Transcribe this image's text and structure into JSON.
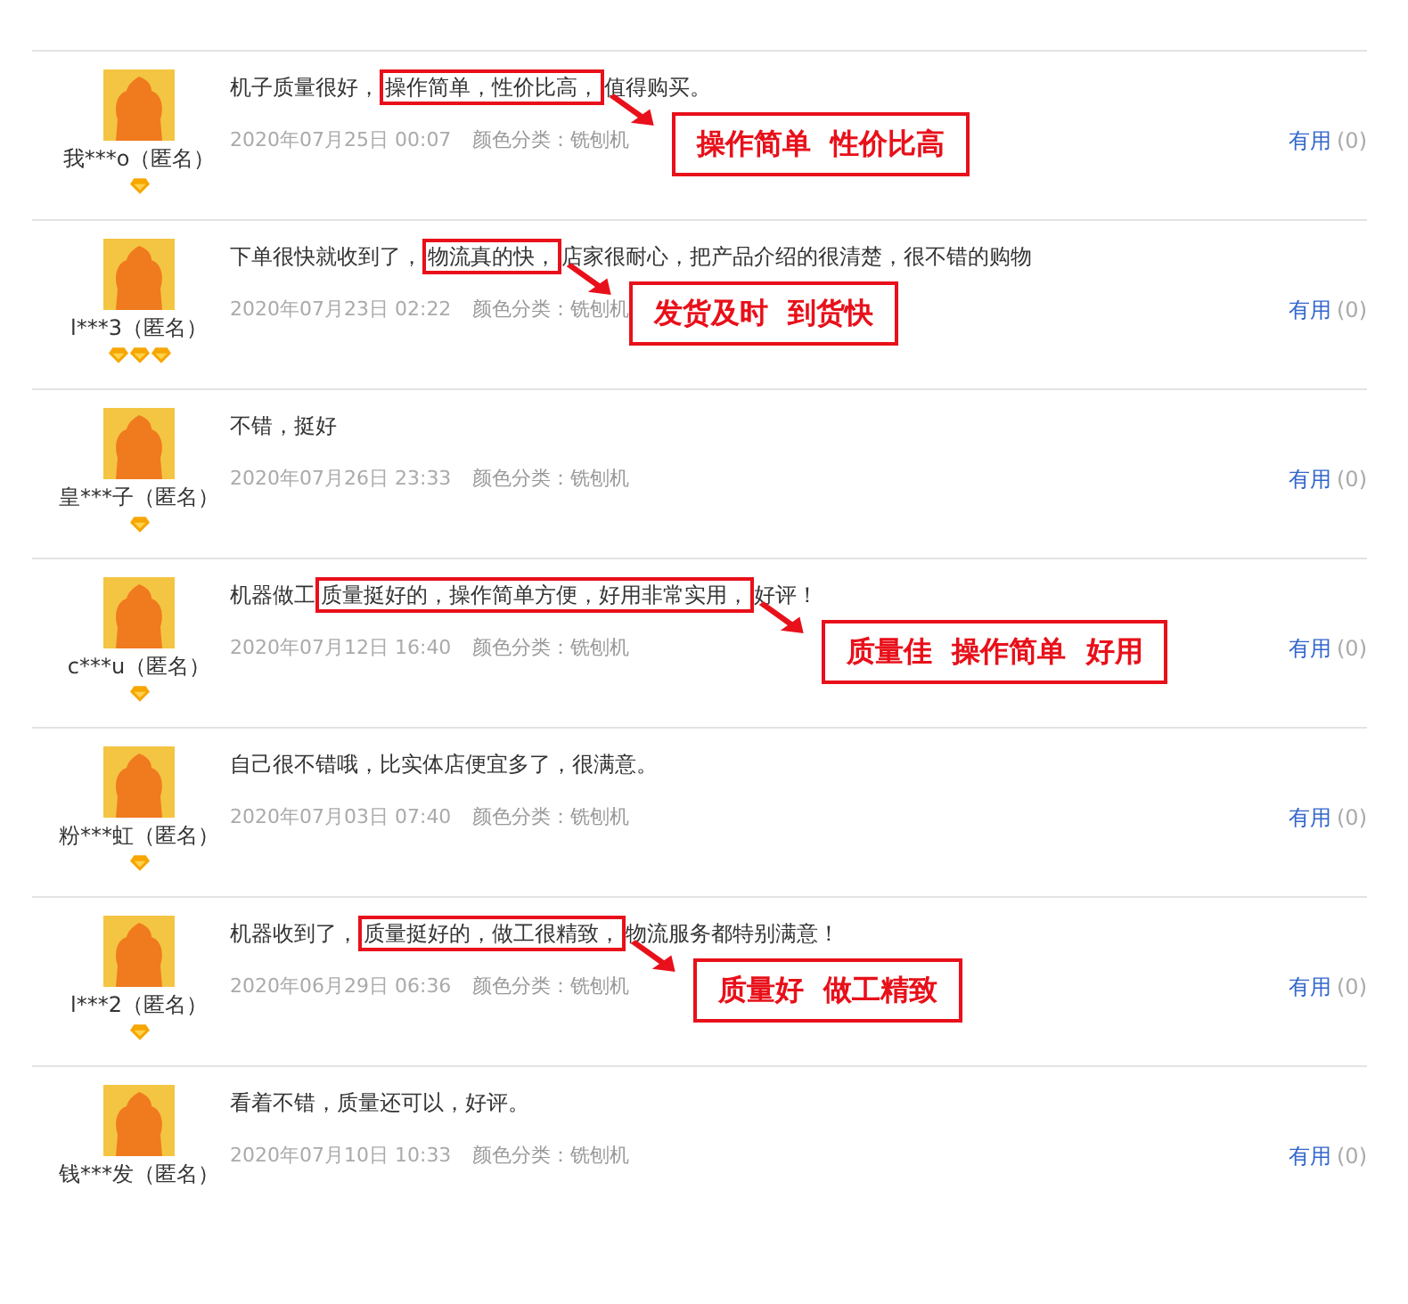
{
  "reviews": [
    {
      "user": "我***o（匿名）",
      "badges": [
        {
          "kind": "diamond"
        }
      ],
      "text_before": "机子质量很好，",
      "highlight": "操作简单，性价比高，",
      "text_after": "值得购买。",
      "date": "2020年07月25日 00:07",
      "sku": "颜色分类：铣刨机",
      "callout": "操作简单  性价比高",
      "helpful_label": "有用",
      "helpful_count": "(0)"
    },
    {
      "user": "l***3（匿名）",
      "badges": [
        {
          "kind": "diamond"
        },
        {
          "kind": "diamond"
        },
        {
          "kind": "diamond"
        }
      ],
      "text_before": "下单很快就收到了，",
      "highlight": "物流真的快，",
      "text_after": "店家很耐心，把产品介绍的很清楚，很不错的购物",
      "date": "2020年07月23日 02:22",
      "sku": "颜色分类：铣刨机",
      "callout": "发货及时  到货快",
      "helpful_label": "有用",
      "helpful_count": "(0)"
    },
    {
      "user": "皇***子（匿名）",
      "badges": [
        {
          "kind": "diamond"
        }
      ],
      "text_before": "不错，挺好",
      "date": "2020年07月26日 23:33",
      "sku": "颜色分类：铣刨机",
      "helpful_label": "有用",
      "helpful_count": "(0)"
    },
    {
      "user": "c***u（匿名）",
      "badges": [
        {
          "kind": "diamond"
        }
      ],
      "text_before": "机器做工",
      "highlight": "质量挺好的，操作简单方便，好用非常实用，",
      "text_after": "好评！",
      "date": "2020年07月12日 16:40",
      "sku": "颜色分类：铣刨机",
      "callout": "质量佳  操作简单  好用",
      "helpful_label": "有用",
      "helpful_count": "(0)"
    },
    {
      "user": "粉***虹（匿名）",
      "badges": [
        {
          "kind": "diamond"
        }
      ],
      "text_before": "自己很不错哦，比实体店便宜多了，很满意。",
      "date": "2020年07月03日 07:40",
      "sku": "颜色分类：铣刨机",
      "helpful_label": "有用",
      "helpful_count": "(0)"
    },
    {
      "user": "l***2（匿名）",
      "badges": [
        {
          "kind": "diamond"
        }
      ],
      "text_before": "机器收到了，",
      "highlight": "质量挺好的，做工很精致，",
      "text_after": "物流服务都特别满意！",
      "date": "2020年06月29日 06:36",
      "sku": "颜色分类：铣刨机",
      "callout": "质量好  做工精致",
      "helpful_label": "有用",
      "helpful_count": "(0)"
    },
    {
      "user": "钱***发（匿名）",
      "text_before": "看着不错，质量还可以，好评。",
      "date": "2020年07月10日 10:33",
      "sku": "颜色分类：铣刨机",
      "helpful_label": "有用",
      "helpful_count": "(0)"
    }
  ]
}
